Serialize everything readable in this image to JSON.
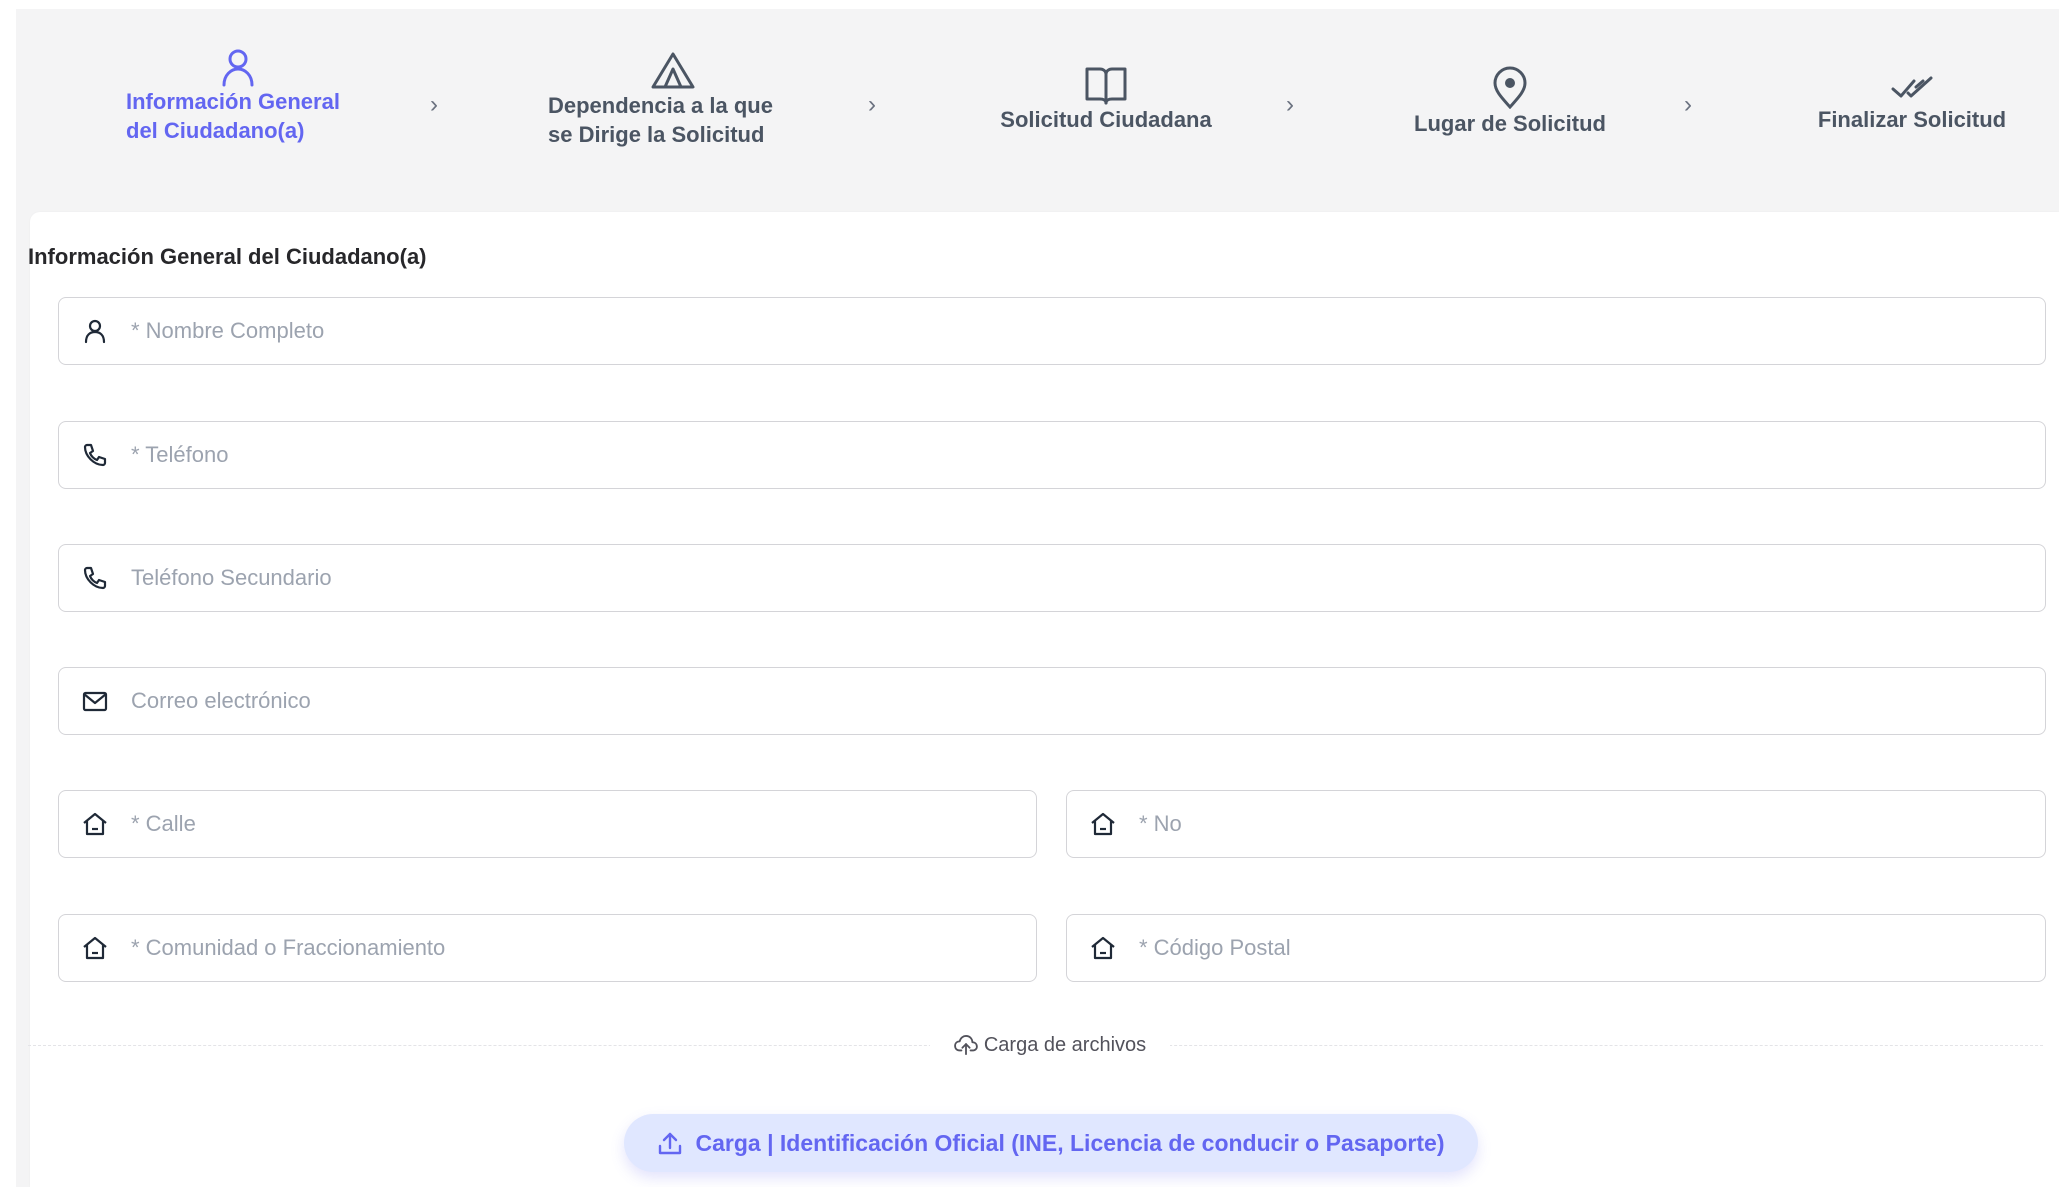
{
  "steps": [
    {
      "line1": "Información General",
      "line2": "del Ciudadano(a)",
      "icon": "user-icon",
      "active": true
    },
    {
      "line1": "Dependencia a la que",
      "line2": "se Dirige la Solicitud",
      "icon": "tent-icon",
      "active": false
    },
    {
      "line1": "Solicitud Ciudadana",
      "icon": "book-icon",
      "active": false
    },
    {
      "line1": "Lugar de Solicitud",
      "icon": "map-pin-icon",
      "active": false
    },
    {
      "line1": "Finalizar Solicitud",
      "icon": "double-check-icon",
      "active": false
    }
  ],
  "colors": {
    "accent": "#6366f1",
    "muted": "#4b5563",
    "background": "#f4f4f5"
  },
  "form": {
    "title": "Información General del Ciudadano(a)",
    "fields": {
      "nombre": {
        "placeholder": "* Nombre Completo",
        "icon": "user-icon"
      },
      "telefono": {
        "placeholder": "* Teléfono",
        "icon": "phone-icon"
      },
      "telefono_secundario": {
        "placeholder": "Teléfono Secundario",
        "icon": "phone-icon"
      },
      "correo": {
        "placeholder": "Correo electrónico",
        "icon": "mail-icon"
      },
      "calle": {
        "placeholder": "* Calle",
        "icon": "home-icon"
      },
      "numero": {
        "placeholder": "* No",
        "icon": "home-icon"
      },
      "comunidad": {
        "placeholder": "* Comunidad o Fraccionamiento",
        "icon": "home-icon"
      },
      "codigo_postal": {
        "placeholder": "* Código Postal",
        "icon": "home-icon"
      }
    },
    "uploads_divider": "Carga de archivos",
    "upload_button": "Carga | Identificación Oficial (INE, Licencia de conducir o Pasaporte)"
  }
}
